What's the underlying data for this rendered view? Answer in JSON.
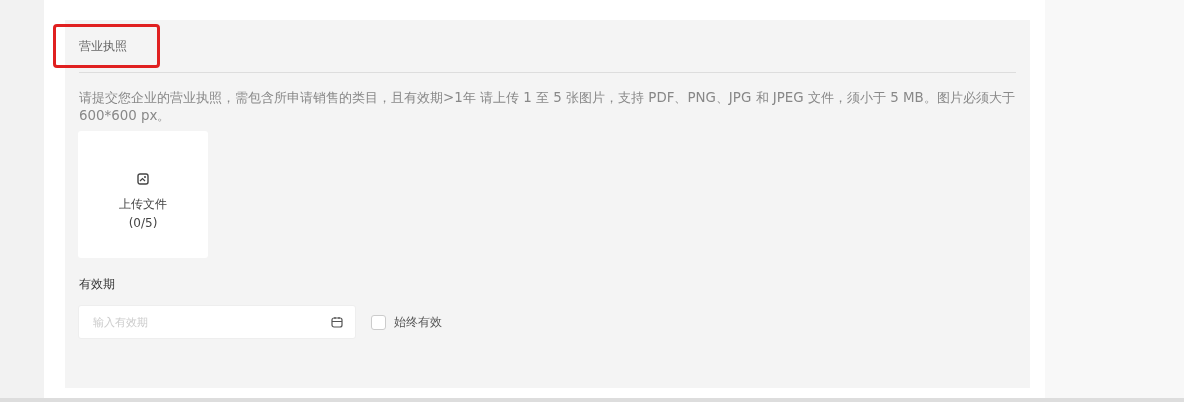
{
  "section": {
    "title": "营业执照",
    "highlighted": true,
    "description": "请提交您企业的营业执照，需包含所申请销售的类目，且有效期>1年 请上传 1 至 5 张图片，支持 PDF、PNG、JPG 和 JPEG 文件，须小于 5 MB。图片必须大于 600*600 px。"
  },
  "upload": {
    "label": "上传文件",
    "count": "(0/5)"
  },
  "validity": {
    "label": "有效期",
    "placeholder": "输入有效期",
    "always_valid": {
      "label": "始终有效",
      "checked": false
    }
  }
}
